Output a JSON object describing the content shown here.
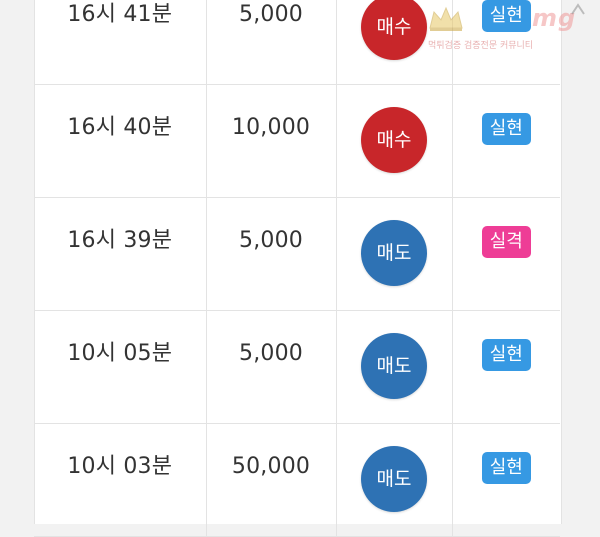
{
  "rows": [
    {
      "time": "16시 41분",
      "amount": "5,000",
      "action": "매수",
      "action_color": "#c8262a",
      "result": "실현",
      "result_color": "#3699e3"
    },
    {
      "time": "16시 40분",
      "amount": "10,000",
      "action": "매수",
      "action_color": "#c8262a",
      "result": "실현",
      "result_color": "#3699e3"
    },
    {
      "time": "16시 39분",
      "amount": "5,000",
      "action": "매도",
      "action_color": "#2e72b4",
      "result": "실격",
      "result_color": "#ee3d96"
    },
    {
      "time": "10시 05분",
      "amount": "5,000",
      "action": "매도",
      "action_color": "#2e72b4",
      "result": "실현",
      "result_color": "#3699e3"
    },
    {
      "time": "10시 03분",
      "amount": "50,000",
      "action": "매도",
      "action_color": "#2e72b4",
      "result": "실현",
      "result_color": "#3699e3"
    }
  ],
  "watermark": {
    "logo": "mg",
    "text": "먹튀검증 검증전문 커뮤니티"
  }
}
